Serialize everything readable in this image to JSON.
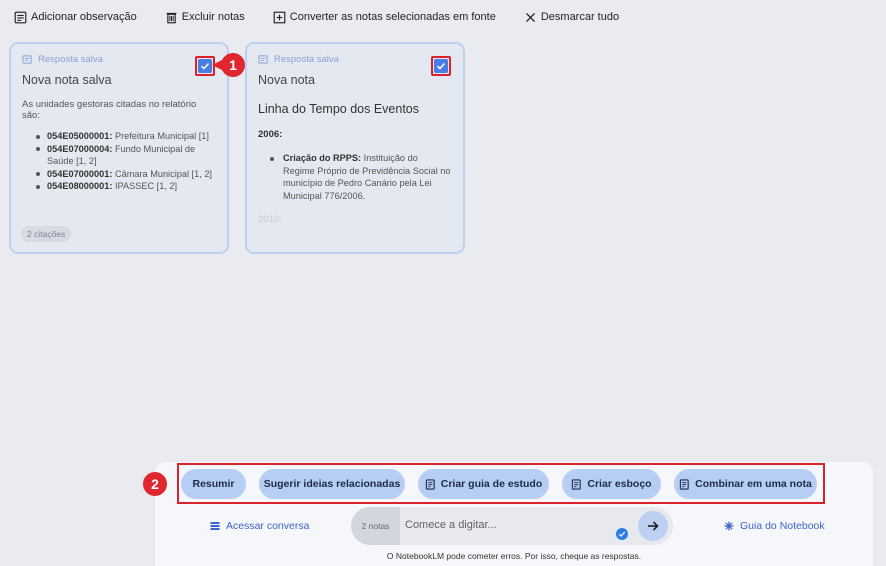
{
  "toolbar": {
    "add_note": "Adicionar observação",
    "delete_notes": "Excluir notas",
    "convert_notes": "Converter as notas selecionadas em fonte",
    "unselect_all": "Desmarcar tudo"
  },
  "cards": [
    {
      "source_label": "Resposta salva",
      "title": "Nova nota salva",
      "intro": "As unidades gestoras citadas no relatório são:",
      "items": [
        {
          "code": "054E05000001:",
          "text": " Prefeitura Municipal [1]"
        },
        {
          "code": "054E07000004:",
          "text": " Fundo Municipal de Saúde [1, 2]"
        },
        {
          "code": "054E07000001:",
          "text": " Câmara Municipal [1, 2]"
        },
        {
          "code": "054E08000001:",
          "text": " IPASSEC [1, 2]"
        }
      ],
      "citations": "2 citações",
      "checked": true
    },
    {
      "source_label": "Resposta salva",
      "title": "Nova nota",
      "subtitle": "Linha do Tempo dos Eventos",
      "year_1": "2006:",
      "item_bold": "Criação do RPPS:",
      "item_text": " Instituição do Regime Próprio de Previdência Social no município de Pedro Canário pela Lei Municipal 776/2006.",
      "year_2": "2010:",
      "checked": true
    }
  ],
  "badges": {
    "one": "1",
    "two": "2"
  },
  "actions": {
    "summarize": "Resumir",
    "suggest": "Sugerir ideias relacionadas",
    "study_guide": "Criar guia de estudo",
    "outline": "Criar esboço",
    "combine": "Combinar em uma nota"
  },
  "chat": {
    "open_chat": "Acessar conversa",
    "notes_count": "2 notas",
    "placeholder": "Comece a digitar...",
    "notebook_guide": "Guia do Notebook",
    "disclaimer": "O NotebookLM pode cometer erros. Por isso, cheque as respostas."
  },
  "colors": {
    "accent": "#4a7de3",
    "chip": "#b6cdf4",
    "highlight": "#d9222a"
  }
}
